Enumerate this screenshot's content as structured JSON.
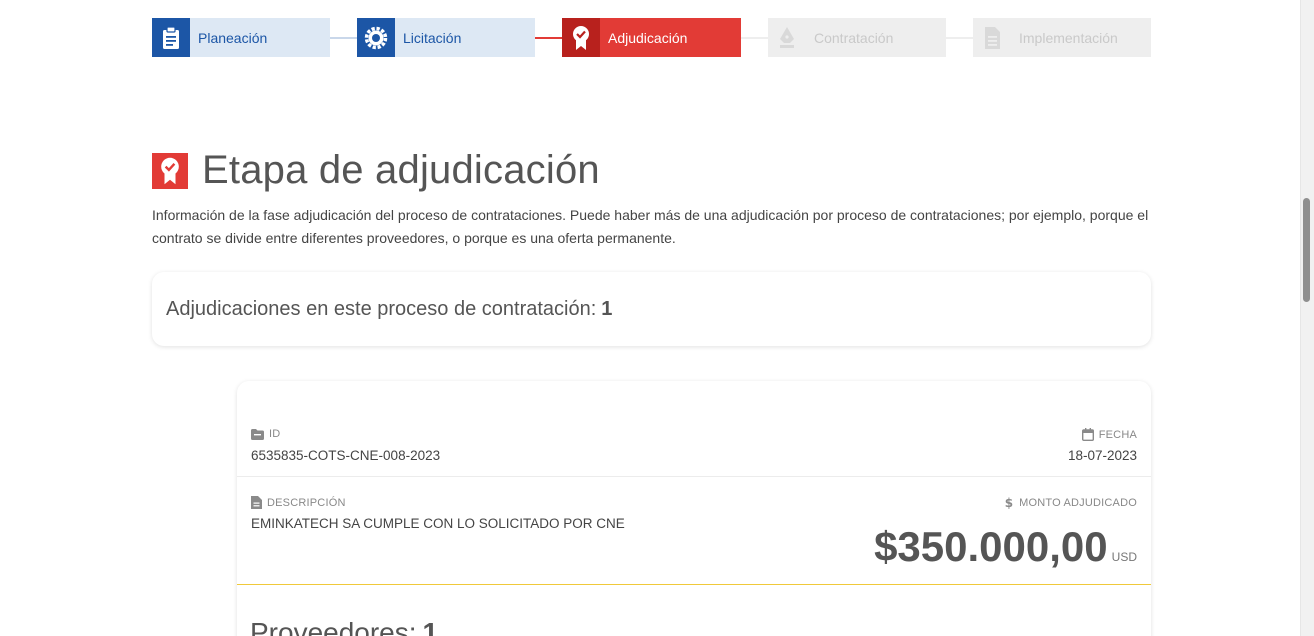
{
  "stepper": {
    "steps": [
      {
        "label": "Planeación",
        "state": "done",
        "icon": "clipboard-icon"
      },
      {
        "label": "Licitación",
        "state": "done",
        "icon": "gear-icon"
      },
      {
        "label": "Adjudicación",
        "state": "active",
        "icon": "award-ribbon-icon"
      },
      {
        "label": "Contratación",
        "state": "todo",
        "icon": "pen-nib-icon"
      },
      {
        "label": "Implementación",
        "state": "todo",
        "icon": "document-icon"
      }
    ]
  },
  "stage": {
    "icon": "award-ribbon-icon",
    "title": "Etapa de adjudicación",
    "description": "Información de la fase adjudicación del proceso de contrataciones. Puede haber más de una adjudicación por proceso de contrataciones; por ejemplo, porque el contrato se divide entre diferentes proveedores, o porque es una oferta permanente."
  },
  "awards_count": {
    "label": "Adjudicaciones en este proceso de contratación:",
    "value": "1"
  },
  "award": {
    "id_label": "ID",
    "id_value": "6535835-COTS-CNE-008-2023",
    "date_label": "FECHA",
    "date_value": "18-07-2023",
    "description_label": "DESCRIPCIÓN",
    "description_value": "EMINKATECH SA CUMPLE CON LO SOLICITADO POR CNE",
    "amount_label": "MONTO ADJUDICADO",
    "amount_value": "$350.000,00",
    "amount_currency": "USD",
    "suppliers_label": "Proveedores:",
    "suppliers_count": "1"
  },
  "colors": {
    "done": "#1c56a6",
    "active": "#e23b36",
    "todo": "#c9c9c9",
    "accent_separator": "#f0c93a"
  }
}
